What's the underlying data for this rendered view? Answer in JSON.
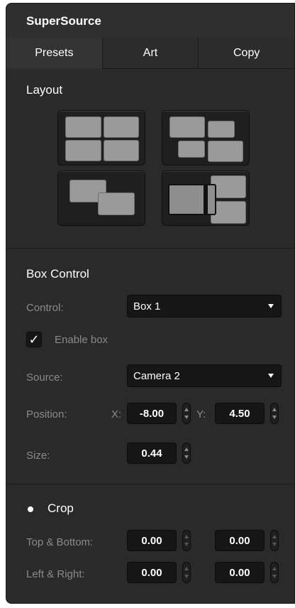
{
  "panel": {
    "title": "SuperSource"
  },
  "tabs": [
    {
      "label": "Presets",
      "active": true
    },
    {
      "label": "Art",
      "active": false
    },
    {
      "label": "Copy",
      "active": false
    }
  ],
  "layout": {
    "title": "Layout",
    "presets": [
      "four-box-grid-icon",
      "staggered-boxes-icon",
      "two-overlapping-boxes-icon",
      "side-panel-boxes-icon"
    ]
  },
  "box_control": {
    "title": "Box Control",
    "control_label": "Control:",
    "control_value": "Box 1",
    "enable_label": "Enable box",
    "enable_checked": true,
    "source_label": "Source:",
    "source_value": "Camera 2",
    "position_label": "Position:",
    "x_label": "X:",
    "x_value": "-8.00",
    "y_label": "Y:",
    "y_value": "4.50",
    "size_label": "Size:",
    "size_value": "0.44"
  },
  "crop": {
    "title": "Crop",
    "enabled": false,
    "top_bottom_label": "Top & Bottom:",
    "top_value": "0.00",
    "bottom_value": "0.00",
    "left_right_label": "Left & Right:",
    "left_value": "0.00",
    "right_value": "0.00"
  },
  "colors": {
    "panel_bg": "#2a2a2a",
    "field_bg": "#161616",
    "label": "#8a8a8a",
    "text": "#ffffff"
  }
}
